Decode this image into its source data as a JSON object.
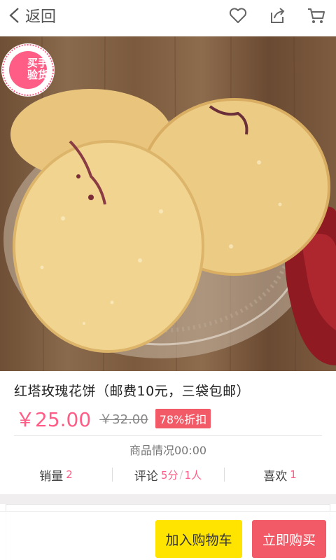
{
  "header": {
    "back_label": "返回",
    "icons": [
      "heart-icon",
      "share-icon",
      "cart-icon"
    ]
  },
  "image": {
    "badge_text_line1": "买手",
    "badge_text_line2": "验货"
  },
  "product": {
    "title": "红塔玫瑰花饼（邮费10元，三袋包邮）",
    "price": "￥25.00",
    "original_price": "￥32.00",
    "discount": "78%折扣",
    "status": "商品情况00:00"
  },
  "stats": {
    "sales_label": "销量",
    "sales_value": "2",
    "reviews_label": "评论",
    "reviews_score": "5分",
    "reviews_sep": "/",
    "reviews_count": "1人",
    "likes_label": "喜欢",
    "likes_value": "1"
  },
  "actions": {
    "add_to_cart": "加入购物车",
    "buy_now": "立即购买"
  },
  "colors": {
    "accent_pink": "#ff5d86",
    "buy_red": "#f15a66",
    "cart_yellow": "#ffe400"
  }
}
